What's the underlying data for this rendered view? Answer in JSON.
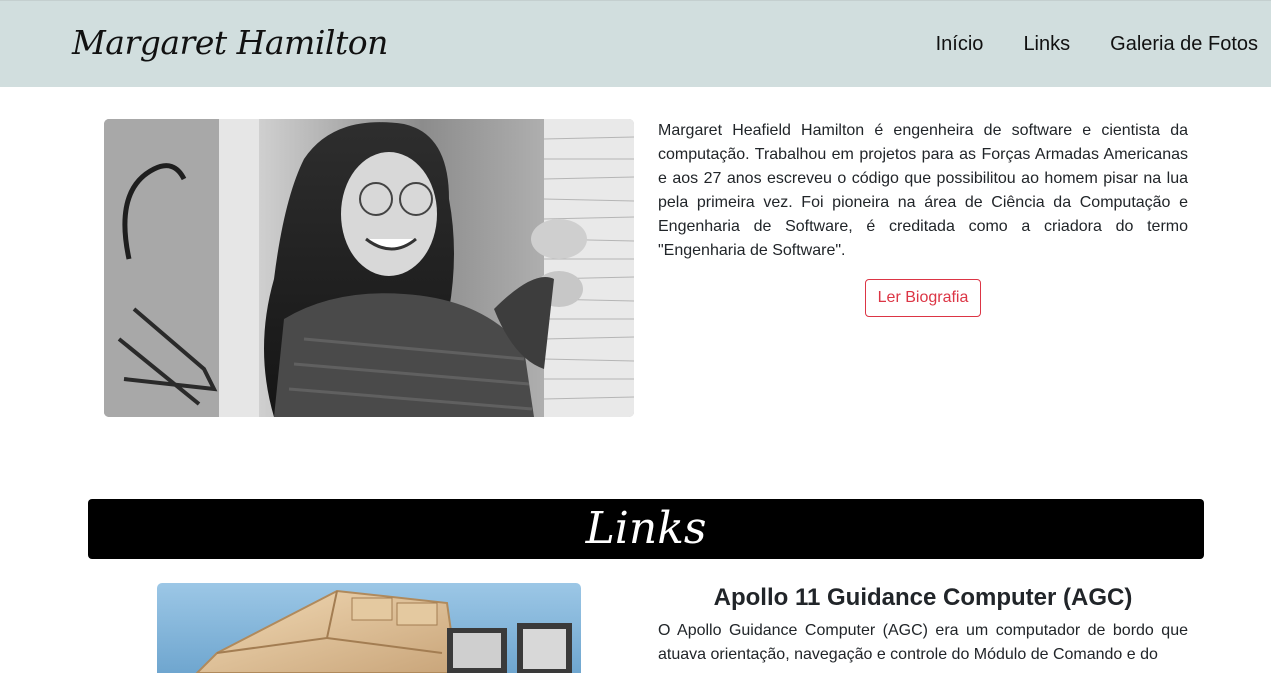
{
  "navbar": {
    "brand": "Margaret Hamilton",
    "links": [
      "Início",
      "Links",
      "Galeria de Fotos"
    ]
  },
  "hero": {
    "photo_icon": "portrait-photo",
    "paragraph": "Margaret Heafield Hamilton é engenheira de software e cientista da computação. Trabalhou em projetos para as Forças Armadas Americanas e aos 27 anos escreveu o código que possibilitou ao homem pisar na lua pela primeira vez. Foi pioneira na área de Ciência da Computação e Engenharia de Software, é creditada como a criadora do termo \"Engenharia de Software\".",
    "button_label": "Ler Biografia"
  },
  "links_section": {
    "heading": "Links",
    "card": {
      "photo_icon": "apollo-guidance-computer-photo",
      "title": "Apollo 11 Guidance Computer (AGC)",
      "text": "O Apollo Guidance Computer (AGC) era um computador de bordo que atuava orientação, navegação e controle do Módulo de Comando e do"
    }
  },
  "colors": {
    "navbar_bg": "#d1dede",
    "button_accent": "#dc3545",
    "banner_bg": "#000000"
  }
}
